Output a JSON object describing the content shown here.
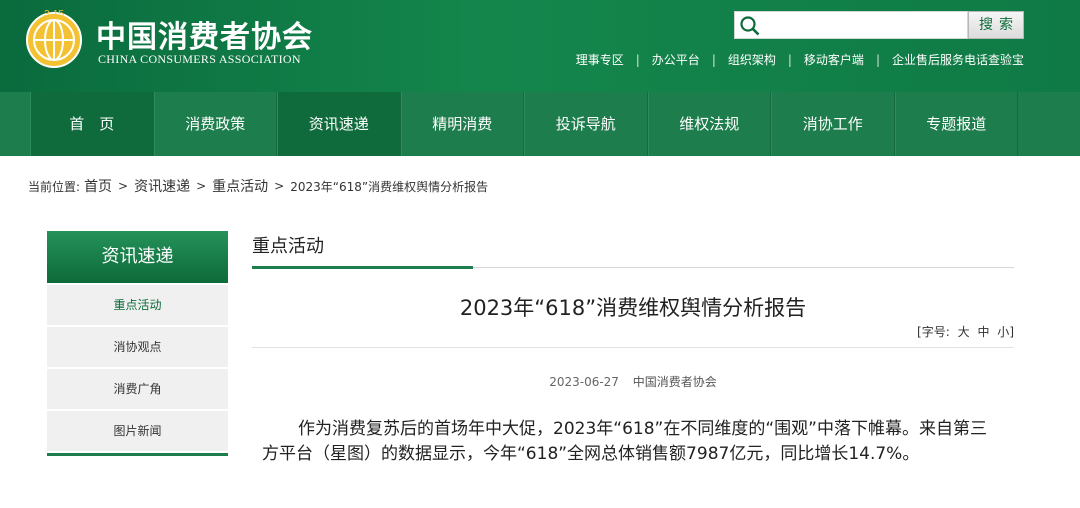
{
  "header": {
    "logo_cn": "中国消费者协会",
    "logo_en": "CHINA CONSUMERS ASSOCIATION",
    "search": {
      "placeholder": "",
      "button": "搜索"
    },
    "top_links": [
      "理事专区",
      "办公平台",
      "组织架构",
      "移动客户端",
      "企业售后服务电话查验宝"
    ]
  },
  "nav": {
    "items": [
      "首　页",
      "消费政策",
      "资讯速递",
      "精明消费",
      "投诉导航",
      "维权法规",
      "消协工作",
      "专题报道"
    ]
  },
  "breadcrumb": {
    "label": "当前位置:",
    "links": [
      "首页",
      "资讯速递",
      "重点活动"
    ],
    "current": "2023年“618”消费维权舆情分析报告"
  },
  "sidebar": {
    "title": "资讯速递",
    "items": [
      "重点活动",
      "消协观点",
      "消费广角",
      "图片新闻"
    ]
  },
  "content": {
    "section_title": "重点活动",
    "article_title": "2023年“618”消费维权舆情分析报告",
    "font_size": {
      "prefix": "[字号:",
      "large": "大",
      "medium": "中",
      "small": "小",
      "suffix": "]"
    },
    "date": "2023-06-27",
    "source": "中国消费者协会",
    "paragraph": "作为消费复苏后的首场年中大促，2023年“618”在不同维度的“围观”中落下帷幕。来自第三方平台（星图）的数据显示，今年“618”全网总体销售额7987亿元，同比增长14.7%。"
  },
  "colors": {
    "brand_green": "#1d7d4c",
    "dark_green": "#0f6b3c"
  }
}
